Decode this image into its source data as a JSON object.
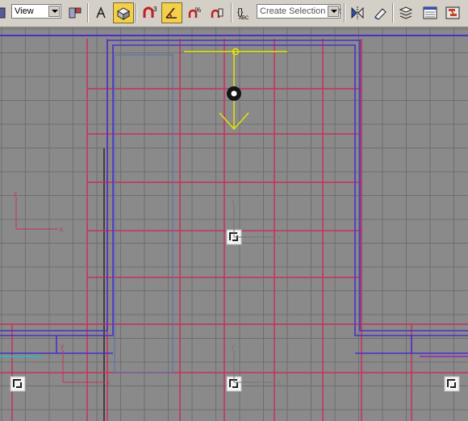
{
  "toolbar": {
    "view_dropdown": {
      "value": "View"
    },
    "selection_set_dropdown": {
      "placeholder": "Create Selection Set"
    },
    "snap_toggle_label": "3",
    "buttons": [
      {
        "name": "select-tool",
        "icon": "cursor-icon",
        "active": false
      },
      {
        "name": "view-dropdown",
        "icon": "dropdown",
        "active": false
      },
      {
        "name": "pivot-center",
        "icon": "pivot-icon",
        "active": false
      },
      {
        "name": "select-manipulate",
        "icon": "manipulate-icon",
        "active": false
      },
      {
        "name": "keyboard-shortcut-override",
        "icon": "keyboard-icon",
        "active": true
      },
      {
        "name": "snaps-toggle",
        "icon": "magnet-3-icon",
        "active": false
      },
      {
        "name": "angle-snap",
        "icon": "angle-snap-icon",
        "active": true
      },
      {
        "name": "percent-snap",
        "icon": "percent-snap-icon",
        "active": false
      },
      {
        "name": "spinner-snap",
        "icon": "spinner-snap-icon",
        "active": false
      },
      {
        "name": "named-selection-sets",
        "icon": "abc-braces-icon",
        "active": false
      },
      {
        "name": "mirror",
        "icon": "mirror-icon",
        "active": false
      },
      {
        "name": "align",
        "icon": "align-icon",
        "active": false
      },
      {
        "name": "layer-manager",
        "icon": "layers-icon",
        "active": false
      },
      {
        "name": "graph-editors",
        "icon": "curve-editor-icon",
        "active": false
      },
      {
        "name": "schematic-view",
        "icon": "schematic-icon",
        "active": false
      }
    ]
  },
  "viewport": {
    "background_color": "#8a8a8a",
    "grid_color": "#6e6e6e",
    "frame_color": "#c8305a",
    "wall_color": "#4a2fc8",
    "gizmo_color": "#e8e800",
    "axis_labels": [
      "y",
      "x",
      "y",
      "x",
      "y",
      "x",
      "y",
      "x"
    ]
  }
}
